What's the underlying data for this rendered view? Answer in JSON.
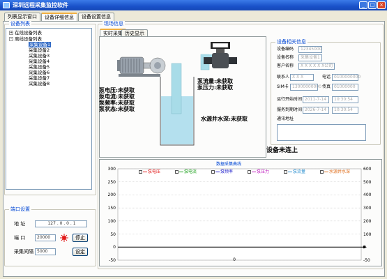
{
  "window": {
    "title": "深圳远程采集监控软件",
    "min": "_",
    "max": "□",
    "close": "×"
  },
  "top_tabs": [
    {
      "label": "列表显示窗口"
    },
    {
      "label": "设备详细信息"
    },
    {
      "label": "设备设置信息"
    }
  ],
  "sidebar": {
    "group_title": "设备列表",
    "tree": [
      {
        "label": "在线设备列表",
        "level": 1,
        "expander": "+",
        "selected": false
      },
      {
        "label": "离线设备列表",
        "level": 1,
        "expander": "-",
        "selected": false
      },
      {
        "label": "采集设备1",
        "level": 2,
        "selected": true
      },
      {
        "label": "采集设备2",
        "level": 2,
        "selected": false
      },
      {
        "label": "采集设备3",
        "level": 2,
        "selected": false
      },
      {
        "label": "采集设备4",
        "level": 2,
        "selected": false
      },
      {
        "label": "采集设备5",
        "level": 2,
        "selected": false
      },
      {
        "label": "采集设备6",
        "level": 2,
        "selected": false
      },
      {
        "label": "采集设备7",
        "level": 2,
        "selected": false
      },
      {
        "label": "采集设备8",
        "level": 2,
        "selected": false
      }
    ]
  },
  "port_settings": {
    "title": "端口设置",
    "address_label": "地  址",
    "address_value": "127 . 0 . 0 . 1",
    "port_label": "端 口",
    "port_value": "20000",
    "stop_button": "停止",
    "interval_label": "采集间隔",
    "interval_value": "5000",
    "set_button": "设定"
  },
  "main": {
    "group_title": "现场信息",
    "subtabs": [
      {
        "label": "实时采集"
      },
      {
        "label": "历史显示"
      }
    ],
    "pump_status": [
      "泵电压:未获取",
      "泵电流:未获取",
      "泵频率:未获取",
      "泵状态:未获取"
    ],
    "flow_status": [
      "泵流量:未获取",
      "泵压力:未获取"
    ],
    "water_depth": "水源井水深:未获取",
    "device_status": "设备未连上"
  },
  "device_info": {
    "title": "设备相关信息",
    "device_no_label": "设备编码",
    "device_no_value": "12345000",
    "device_name_label": "设备名称",
    "device_name_value": "采集设备1",
    "customer_label": "客户名称",
    "customer_value": "X X X X X X公司",
    "contact_label": "联系人",
    "contact_value": "X X X",
    "phone_label": "电话",
    "phone_value": "0100000000",
    "sim_label": "SIM卡",
    "sim_value": "13000000000",
    "fax_label": "传真",
    "fax_value": "01000000",
    "run_start_label": "运行开始时间",
    "run_start_date": "2011-7-14",
    "run_start_time": "10:30:54",
    "service_label": "服务到期时间",
    "service_date": "2026-7-14",
    "service_time": "10:30:54",
    "remark_label": "通讯地址"
  },
  "chart_data": {
    "type": "line",
    "title": "数据采集曲线",
    "legend": [
      "泵电压",
      "泵电流",
      "泵频率",
      "泵压力",
      "泵流量",
      "水源井水深"
    ],
    "left_ticks": [
      "300",
      "250",
      "200",
      "150",
      "100",
      "50",
      "0",
      "-50"
    ],
    "right_ticks": [
      "600",
      "500",
      "400",
      "300",
      "200",
      "100",
      "0",
      "-50"
    ],
    "ylim_left": [
      -50,
      300
    ],
    "ylim_right": [
      -50,
      600
    ],
    "x_tick": "0",
    "grid": true,
    "series": []
  },
  "colors": {
    "accent": "#0046d5",
    "selection": "#316ac5",
    "titlebar": "#1a52c9",
    "water": "#b4e0ee",
    "pipe": "#a8dce8"
  }
}
